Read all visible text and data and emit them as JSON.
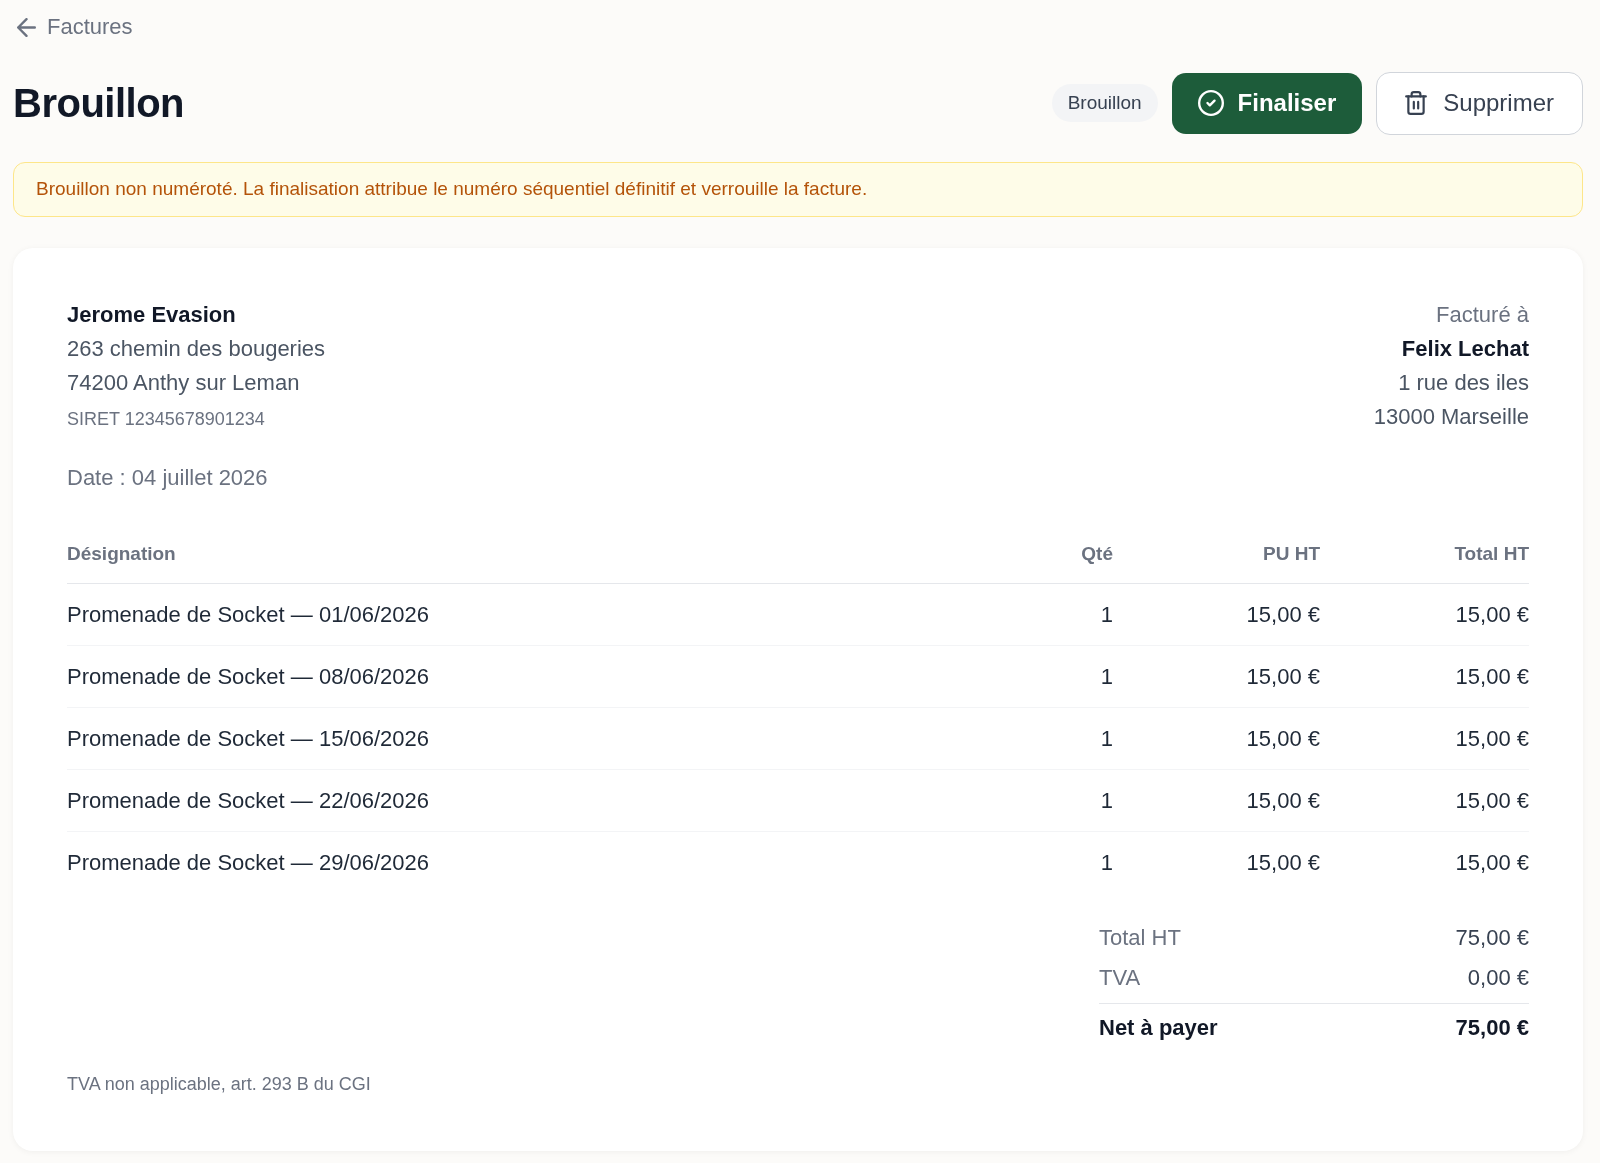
{
  "back_link": {
    "label": "Factures"
  },
  "title": "Brouillon",
  "status_badge": "Brouillon",
  "actions": [
    {
      "label": "Finaliser",
      "kind": "confirm"
    },
    {
      "label": "Supprimer",
      "kind": "delete"
    }
  ],
  "notice": "Brouillon non numéroté. La finalisation attribue le numéro séquentiel définitif et verrouille la facture.",
  "invoice": {
    "issuer": {
      "name": "Jerome Evasion",
      "address_lines": [
        "263 chemin des bougeries",
        "74200 Anthy sur Leman"
      ],
      "siret": "SIRET 12345678901234"
    },
    "date": "Date : 04 juillet 2026",
    "billed_to": {
      "heading": "Facturé à",
      "name": "Felix Lechat",
      "address_lines": [
        "1 rue des iles",
        "13000 Marseille"
      ]
    },
    "table": {
      "columns": [
        {
          "label": "Désignation"
        },
        {
          "label": "Qté"
        },
        {
          "label": "PU HT"
        },
        {
          "label": "Total HT"
        }
      ],
      "rows": [
        [
          "Promenade de Socket — 01/06/2026",
          "1",
          "15,00 €",
          "15,00 €"
        ],
        [
          "Promenade de Socket — 08/06/2026",
          "1",
          "15,00 €",
          "15,00 €"
        ],
        [
          "Promenade de Socket — 15/06/2026",
          "1",
          "15,00 €",
          "15,00 €"
        ],
        [
          "Promenade de Socket — 22/06/2026",
          "1",
          "15,00 €",
          "15,00 €"
        ],
        [
          "Promenade de Socket — 29/06/2026",
          "1",
          "15,00 €",
          "15,00 €"
        ]
      ]
    },
    "totals": [
      {
        "label": "Total HT",
        "value": "75,00 €",
        "kind": "line"
      },
      {
        "label": "TVA",
        "value": "0,00 €",
        "kind": "line"
      },
      {
        "label": "Net à payer",
        "value": "75,00 €",
        "kind": "grand"
      }
    ],
    "footer_note": "TVA non applicable, art. 293 B du CGI"
  }
}
